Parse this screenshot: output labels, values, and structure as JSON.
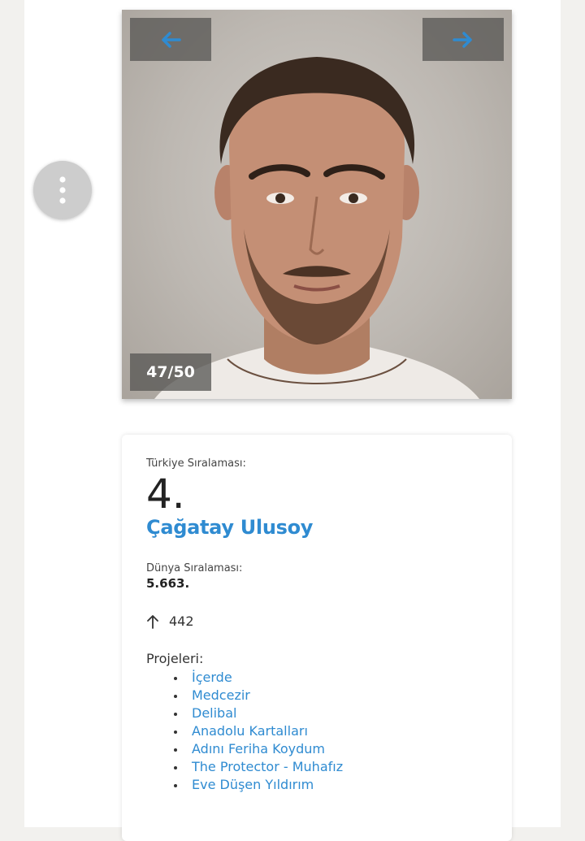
{
  "gallery": {
    "prev_icon": "arrow-left-icon",
    "next_icon": "arrow-right-icon",
    "counter": "47/50",
    "accent_color": "#2f8bd1"
  },
  "menu": {
    "icon": "more-vertical-icon"
  },
  "card": {
    "turkey_rank_label": "Türkiye Sıralaması:",
    "turkey_rank": "4.",
    "name": "Çağatay Ulusoy",
    "world_rank_label": "Dünya Sıralaması:",
    "world_rank": "5.663.",
    "change_icon": "arrow-up-icon",
    "change_value": "442",
    "projects_label": "Projeleri:",
    "projects": [
      "İçerde",
      "Medcezir",
      "Delibal",
      "Anadolu Kartalları",
      "Adını Feriha Koydum",
      "The Protector - Muhafız",
      "Eve Düşen Yıldırım"
    ]
  }
}
